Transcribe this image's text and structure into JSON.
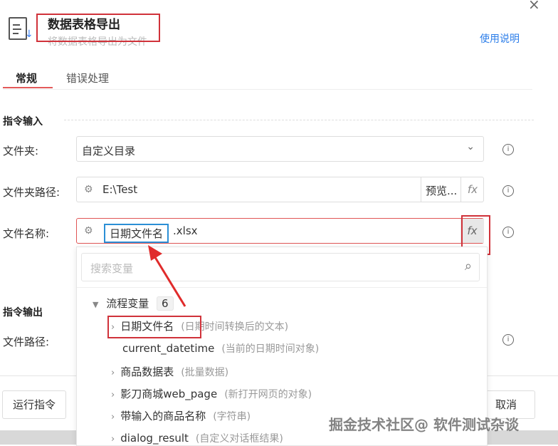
{
  "dialog": {
    "title": "数据表格导出",
    "subtitle": "将数据表格导出为文件",
    "help_link": "使用说明",
    "close": "×"
  },
  "tabs": [
    {
      "label": "常规",
      "active": true
    },
    {
      "label": "错误处理",
      "active": false
    }
  ],
  "input_section": "指令输入",
  "fields": {
    "folder": {
      "label": "文件夹:",
      "value": "自定义目录"
    },
    "folder_path": {
      "label": "文件夹路径:",
      "value": "E:\\Test",
      "preview": "预览...",
      "fx": "fx"
    },
    "file_name": {
      "label": "文件名称:",
      "variable": "日期文件名",
      "suffix": ".xlsx",
      "fx": "fx"
    }
  },
  "output_section": "指令输出",
  "output_fields": {
    "file_path": {
      "label": "文件路径:"
    }
  },
  "dropdown": {
    "search_placeholder": "搜索变量",
    "group": {
      "label": "流程变量",
      "count": "6"
    },
    "items": [
      {
        "name": "日期文件名",
        "desc": "(日期时间转换后的文本)",
        "expandable": true
      },
      {
        "name": "current_datetime",
        "desc": "(当前的日期时间对象)",
        "expandable": false
      },
      {
        "name": "商品数据表",
        "desc": "(批量数据)",
        "expandable": true
      },
      {
        "name": "影刀商城web_page",
        "desc": "(新打开网页的对象)",
        "expandable": true
      },
      {
        "name": "带输入的商品名称",
        "desc": "(字符串)",
        "expandable": true
      },
      {
        "name": "dialog_result",
        "desc": "(自定义对话框结果)",
        "expandable": true
      }
    ]
  },
  "footer": {
    "run": "运行指令",
    "cancel": "取消"
  },
  "watermark": "掘金技术社区@ 软件测试杂谈",
  "colors": {
    "accent": "#2b7de9",
    "highlight": "#d0323a",
    "tab_active": "#e35a5a",
    "var_tag": "#2b8fd6"
  }
}
